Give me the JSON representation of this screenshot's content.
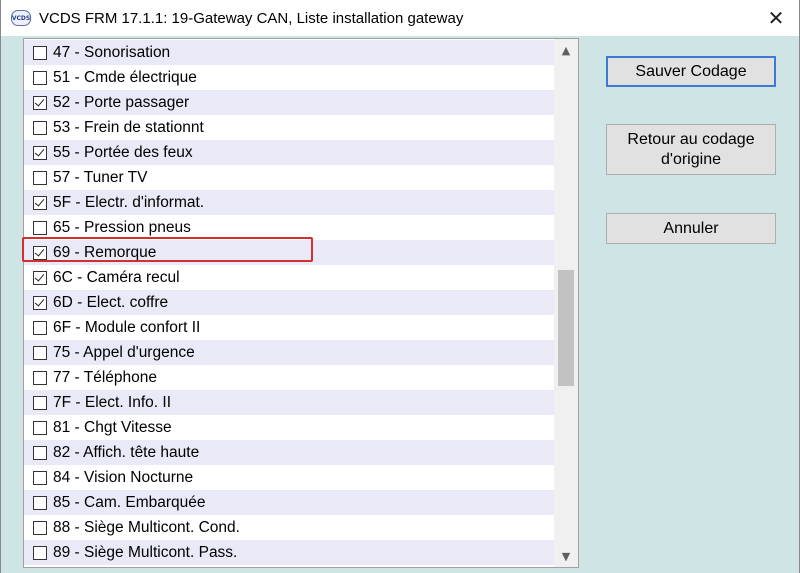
{
  "window": {
    "title": "VCDS FRM 17.1.1: 19-Gateway CAN,  Liste installation gateway",
    "icon_text": "VCDS",
    "close_glyph": "✕"
  },
  "list": {
    "items": [
      {
        "label": "47 - Sonorisation",
        "checked": false
      },
      {
        "label": "51 - Cmde électrique",
        "checked": false
      },
      {
        "label": "52 - Porte passager",
        "checked": true
      },
      {
        "label": "53 - Frein de stationnt",
        "checked": false
      },
      {
        "label": "55 - Portée des feux",
        "checked": true
      },
      {
        "label": "57 - Tuner TV",
        "checked": false
      },
      {
        "label": "5F - Electr. d'informat.",
        "checked": true
      },
      {
        "label": "65 - Pression pneus",
        "checked": false
      },
      {
        "label": "69 - Remorque",
        "checked": true
      },
      {
        "label": "6C - Caméra recul",
        "checked": true
      },
      {
        "label": "6D - Elect. coffre",
        "checked": true
      },
      {
        "label": "6F - Module confort II",
        "checked": false
      },
      {
        "label": "75 - Appel d'urgence",
        "checked": false
      },
      {
        "label": "77 - Téléphone",
        "checked": false
      },
      {
        "label": "7F - Elect. Info. II",
        "checked": false
      },
      {
        "label": "81 - Chgt Vitesse",
        "checked": false
      },
      {
        "label": "82 - Affich. tête haute",
        "checked": false
      },
      {
        "label": "84 - Vision Nocturne",
        "checked": false
      },
      {
        "label": "85 - Cam. Embarquée",
        "checked": false
      },
      {
        "label": "88 - Siège Multicont. Cond.",
        "checked": false
      },
      {
        "label": "89 - Siège Multicont. Pass.",
        "checked": false
      }
    ],
    "highlighted_item": "69 - Remorque"
  },
  "buttons": {
    "save": "Sauver Codage",
    "restore_line1": "Retour au codage",
    "restore_line2": "d'origine",
    "cancel": "Annuler"
  },
  "icons": {
    "scroll_up": "chevron-up-icon",
    "scroll_down": "chevron-down-icon",
    "close": "close-icon"
  },
  "colors": {
    "background": "#cfe4e4",
    "row_alt": "#e9e9f7",
    "highlight": "#d32f2f",
    "default_button_border": "#3b7bd1"
  }
}
